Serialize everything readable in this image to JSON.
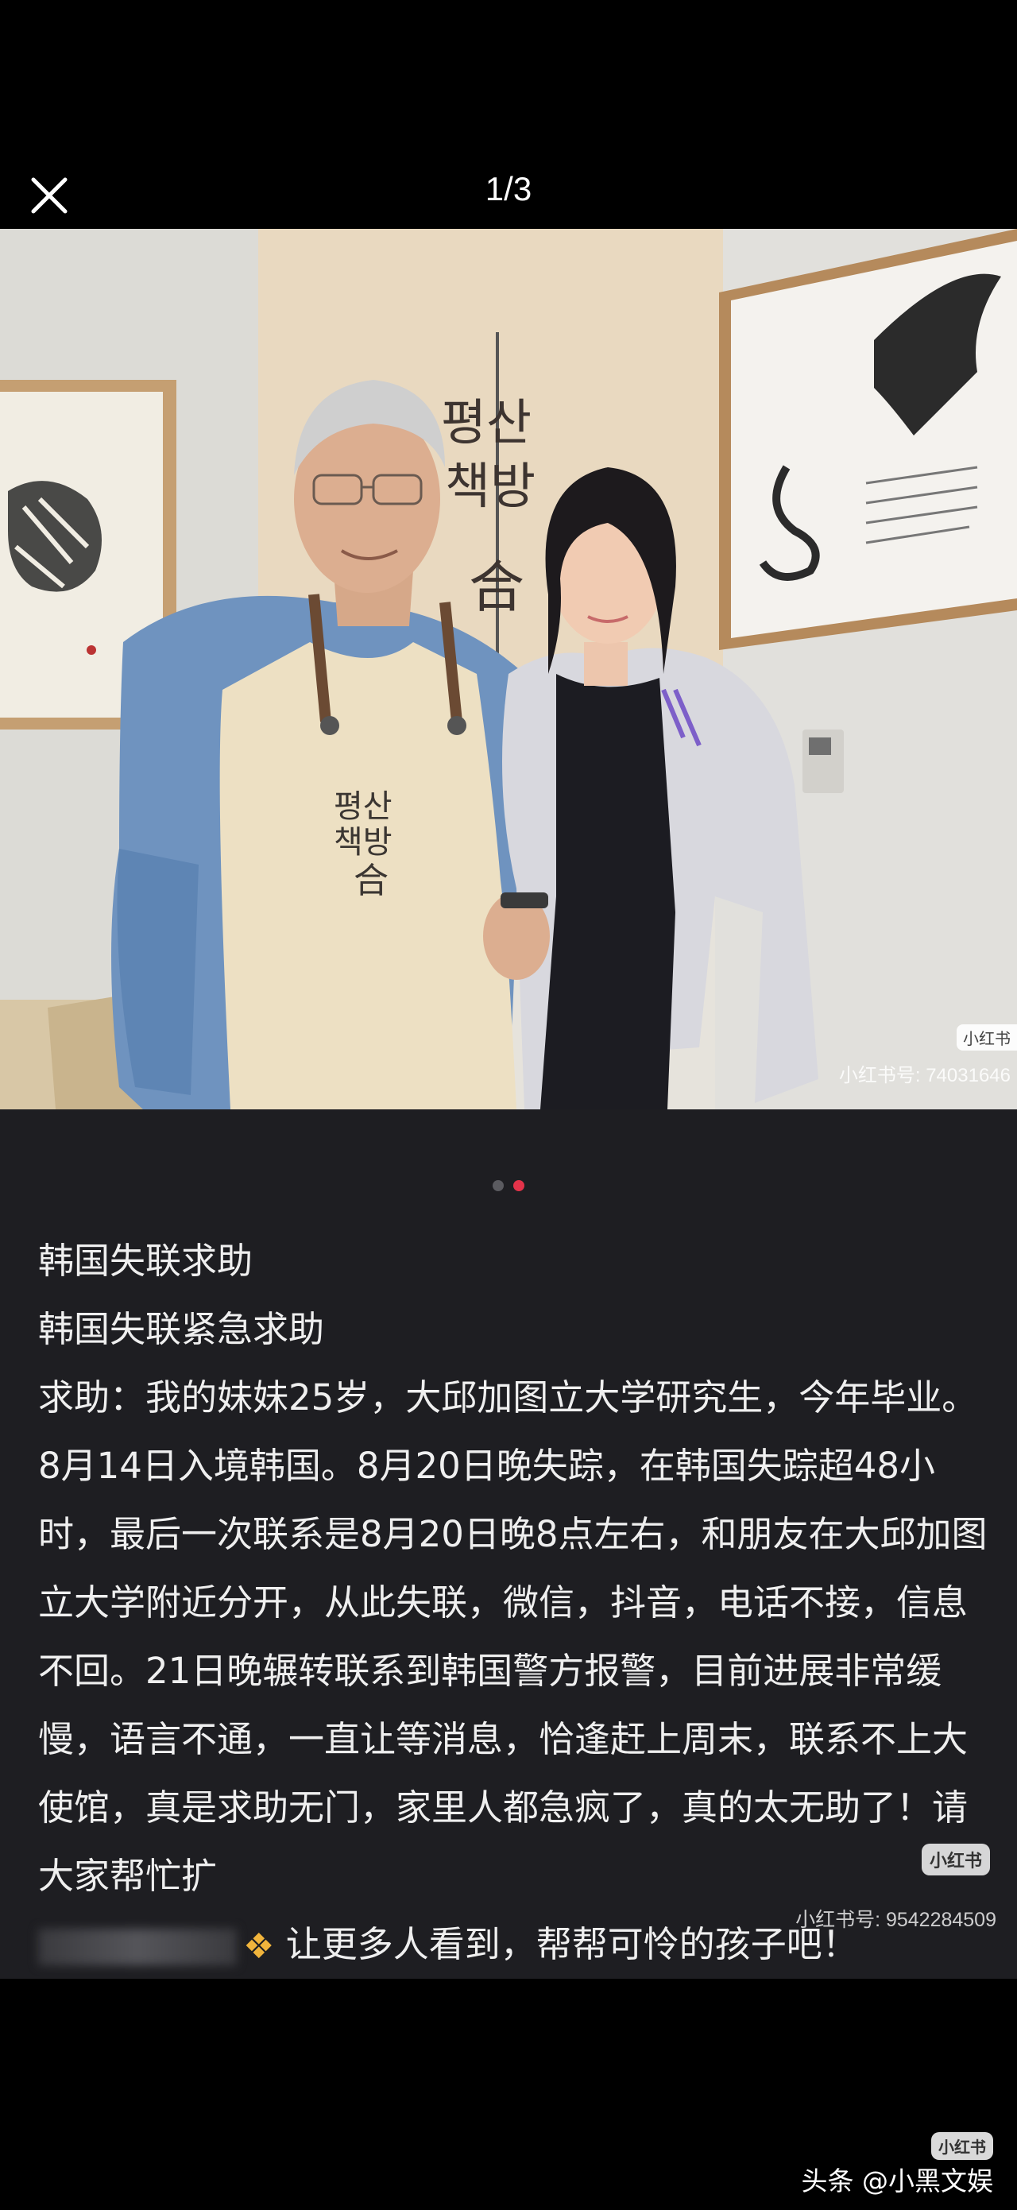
{
  "header": {
    "close_icon": "close-icon",
    "counter": "1/3"
  },
  "photo": {
    "watermark": "小红书号: 74031646",
    "logo": "小红书",
    "apron_text_top": "평산",
    "apron_text_mid": "책방",
    "apron_text_bottom": "合",
    "wall_calligraphy_top": "평산",
    "wall_calligraphy_mid": "책방",
    "wall_calligraphy_bottom": "合"
  },
  "pagination": {
    "total": 2,
    "active_index": 1,
    "active_color": "#e3334a",
    "inactive_color": "#5b5b60"
  },
  "caption": {
    "line1": "韩国失联求助",
    "line2": "韩国失联紧急求助",
    "body": "求助：我的妹妹25岁，大邱加图立大学研究生，今年毕业。8月14日入境韩国。8月20日晚失踪，在韩国失踪超48小时，最后一次联系是8月20日晚8点左右，和朋友在大邱加图立大学附近分开，从此失联，微信，抖音，电话不接，信息不回。21日晚辗转联系到韩国警方报警，目前进展非常缓慢，语言不通，一直让等消息，恰逢赶上周末，联系不上大使馆，真是求助无门，家里人都急疯了，真的太无助了！请大家帮忙扩",
    "last_line_icon": "praying-hands-icon",
    "last_line": "让更多人看到，帮帮可怜的孩子吧！",
    "watermark": "小红书号: 9542284509",
    "logo": "小红书"
  },
  "footer": {
    "logo": "小红书",
    "source": "头条 @小黑文娱"
  }
}
